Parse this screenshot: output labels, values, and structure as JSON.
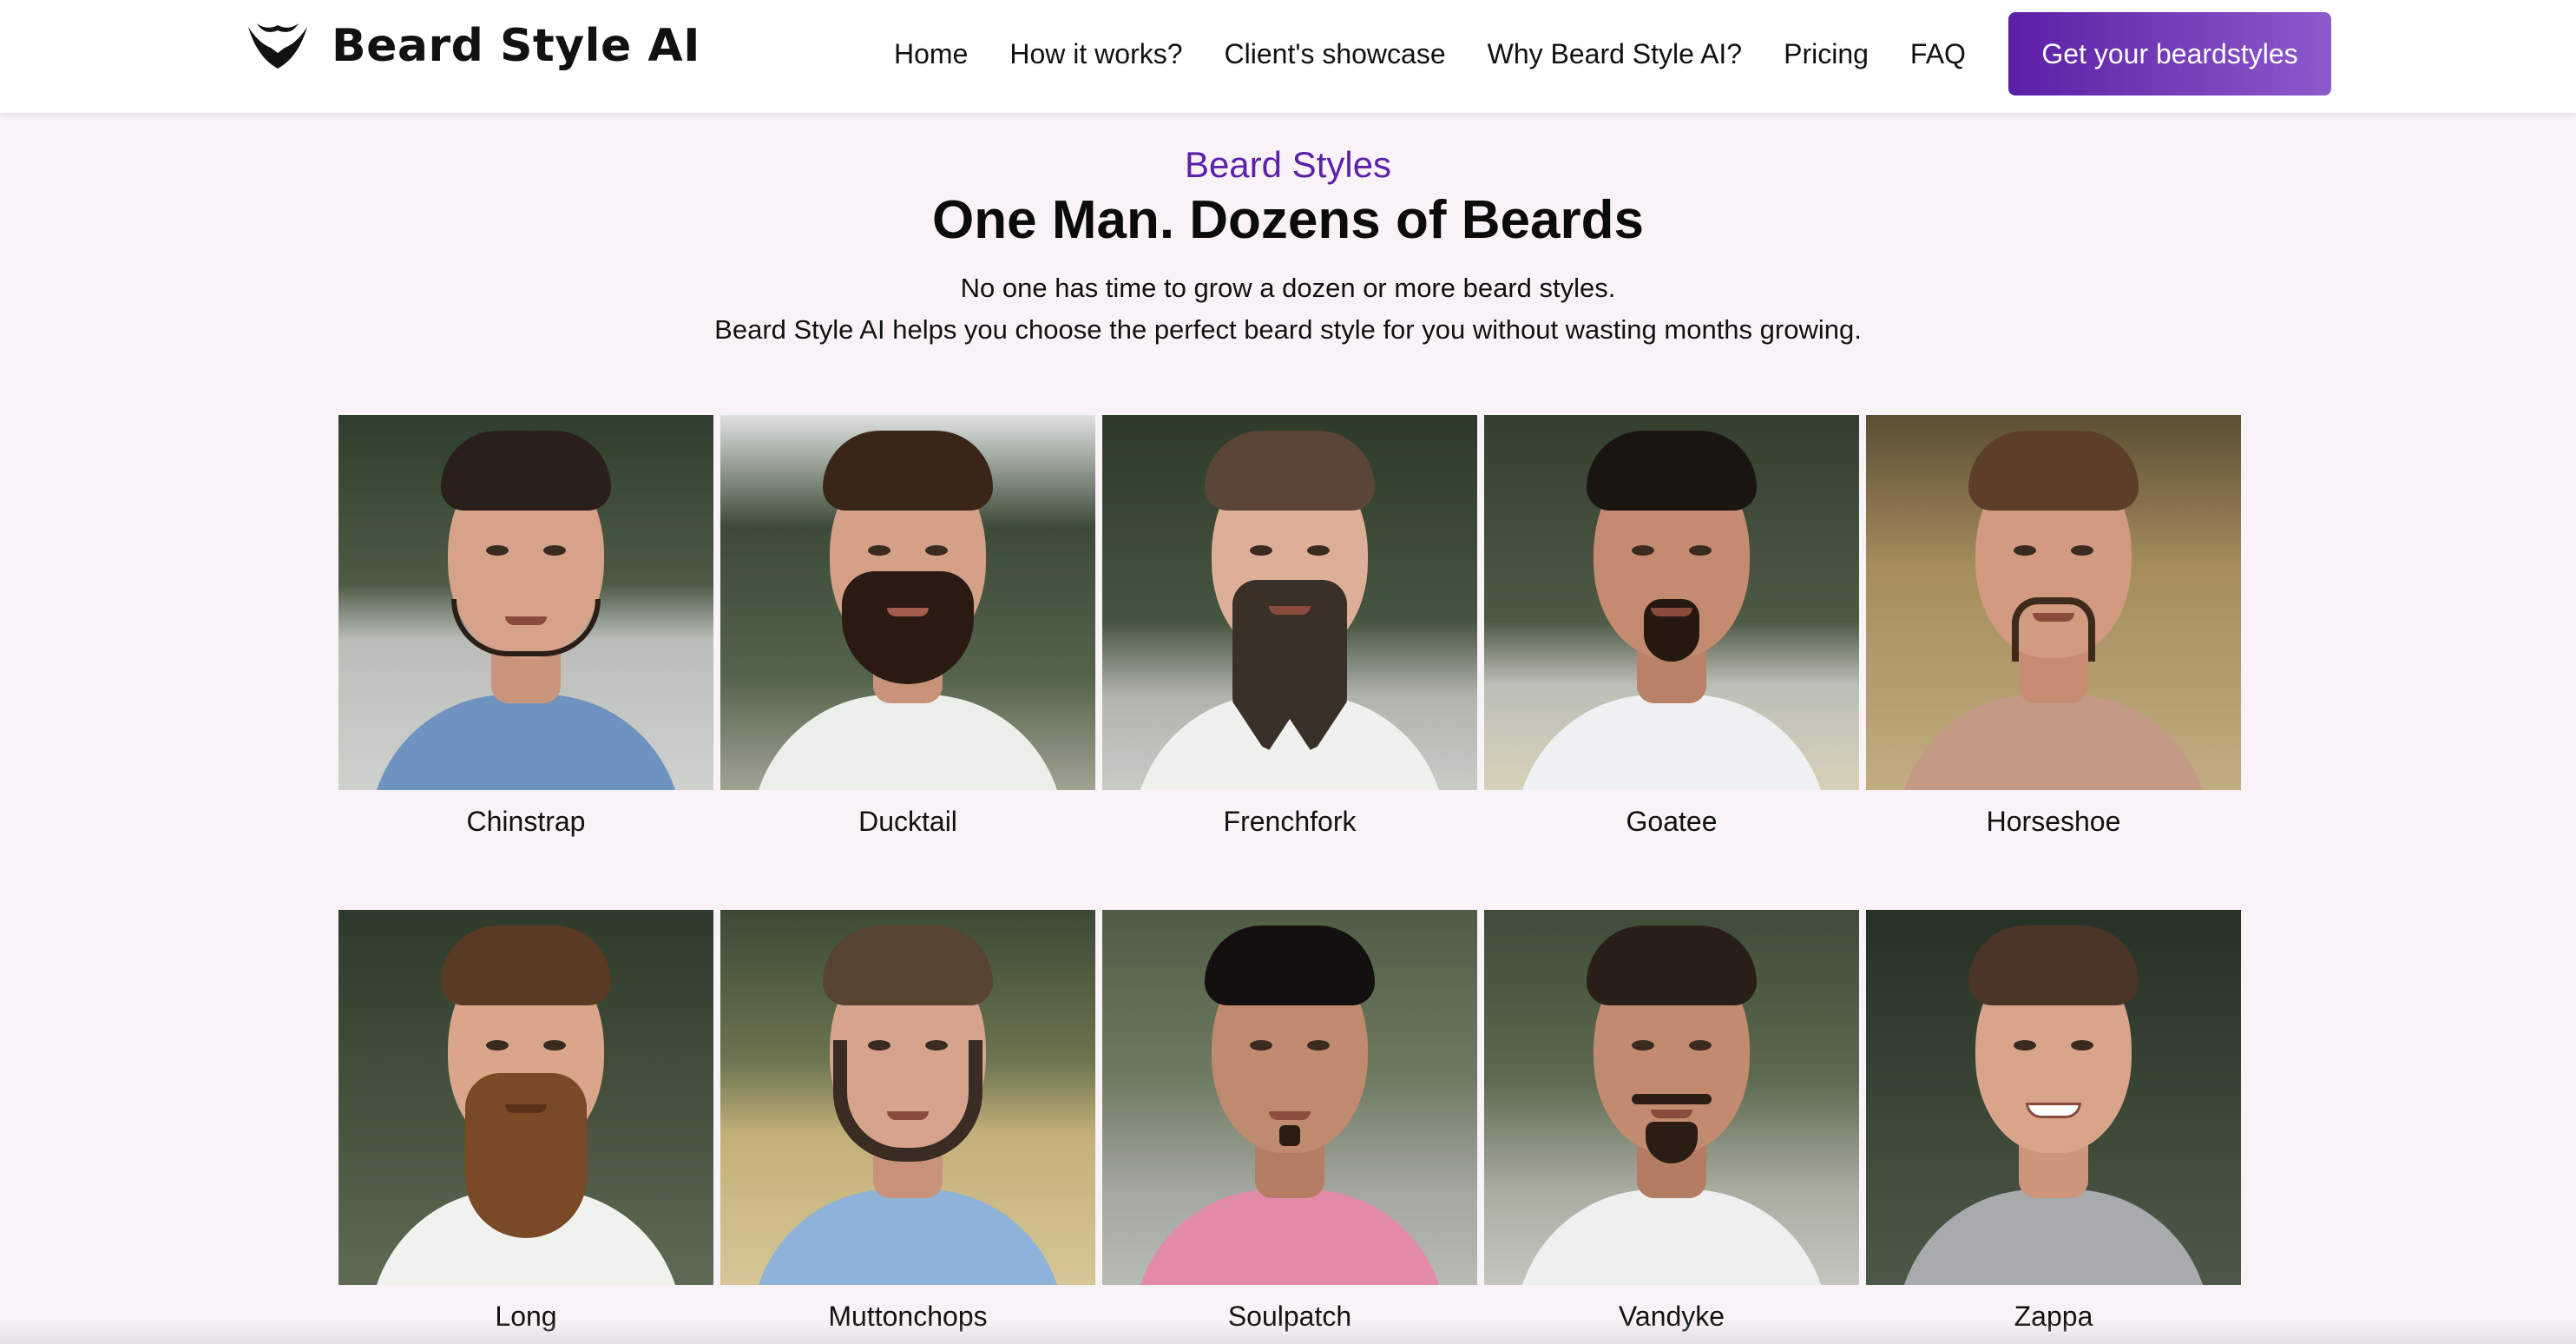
{
  "header": {
    "brand": "Beard Style AI",
    "logo_icon": "beard-mustache-icon",
    "nav": [
      "Home",
      "How it works?",
      "Client's showcase",
      "Why Beard Style AI?",
      "Pricing",
      "FAQ"
    ],
    "cta": "Get your beardstyles",
    "colors": {
      "cta_start": "#5b1fa6",
      "cta_end": "#8d5acb"
    }
  },
  "hero": {
    "eyebrow": "Beard Styles",
    "title": "One Man. Dozens of Beards",
    "subtitle_line1": "No one has time to grow a dozen or more beard styles.",
    "subtitle_line2": "Beard Style AI helps you choose the perfect beard style for you without wasting months growing.",
    "colors": {
      "eyebrow": "#5a22a8"
    }
  },
  "styles": [
    {
      "name": "Chinstrap"
    },
    {
      "name": "Ducktail"
    },
    {
      "name": "Frenchfork"
    },
    {
      "name": "Goatee"
    },
    {
      "name": "Horseshoe"
    },
    {
      "name": "Long"
    },
    {
      "name": "Muttonchops"
    },
    {
      "name": "Soulpatch"
    },
    {
      "name": "Vandyke"
    },
    {
      "name": "Zappa"
    }
  ]
}
